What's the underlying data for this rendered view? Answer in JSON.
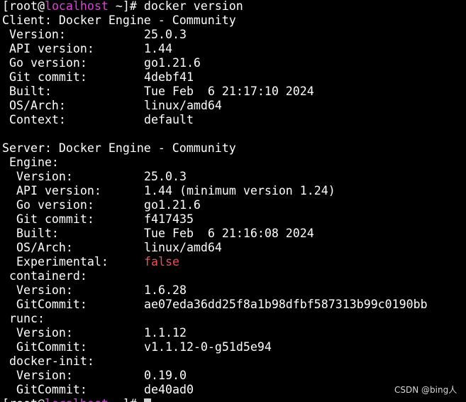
{
  "prompt": {
    "open": "[root@",
    "host": "localhost",
    "close": " ~]# ",
    "command": "docker version"
  },
  "client": {
    "header": "Client: Docker Engine - Community",
    "rows": [
      {
        "label": " Version:",
        "value": "25.0.3"
      },
      {
        "label": " API version:",
        "value": "1.44"
      },
      {
        "label": " Go version:",
        "value": "go1.21.6"
      },
      {
        "label": " Git commit:",
        "value": "4debf41"
      },
      {
        "label": " Built:",
        "value": "Tue Feb  6 21:17:10 2024"
      },
      {
        "label": " OS/Arch:",
        "value": "linux/amd64"
      },
      {
        "label": " Context:",
        "value": "default"
      }
    ]
  },
  "server": {
    "header": "Server: Docker Engine - Community",
    "engine": {
      "title": " Engine:",
      "rows": [
        {
          "label": "  Version:",
          "value": "25.0.3"
        },
        {
          "label": "  API version:",
          "value": "1.44 (minimum version 1.24)"
        },
        {
          "label": "  Go version:",
          "value": "go1.21.6"
        },
        {
          "label": "  Git commit:",
          "value": "f417435"
        },
        {
          "label": "  Built:",
          "value": "Tue Feb  6 21:16:08 2024"
        },
        {
          "label": "  OS/Arch:",
          "value": "linux/amd64"
        },
        {
          "label": "  Experimental:",
          "value": "false"
        }
      ]
    },
    "containerd": {
      "title": " containerd:",
      "rows": [
        {
          "label": "  Version:",
          "value": "1.6.28"
        },
        {
          "label": "  GitCommit:",
          "value": "ae07eda36dd25f8a1b98dfbf587313b99c0190bb"
        }
      ]
    },
    "runc": {
      "title": " runc:",
      "rows": [
        {
          "label": "  Version:",
          "value": "1.1.12"
        },
        {
          "label": "  GitCommit:",
          "value": "v1.1.12-0-g51d5e94"
        }
      ]
    },
    "docker_init": {
      "title": " docker-init:",
      "rows": [
        {
          "label": "  Version:",
          "value": "0.19.0"
        },
        {
          "label": "  GitCommit:",
          "value": "de40ad0"
        }
      ]
    }
  },
  "watermark": "CSDN @bing人",
  "colors": {
    "background": "#000000",
    "text": "#ffffff",
    "hostname": "#e040e0",
    "false_value": "#ef4f4f"
  }
}
